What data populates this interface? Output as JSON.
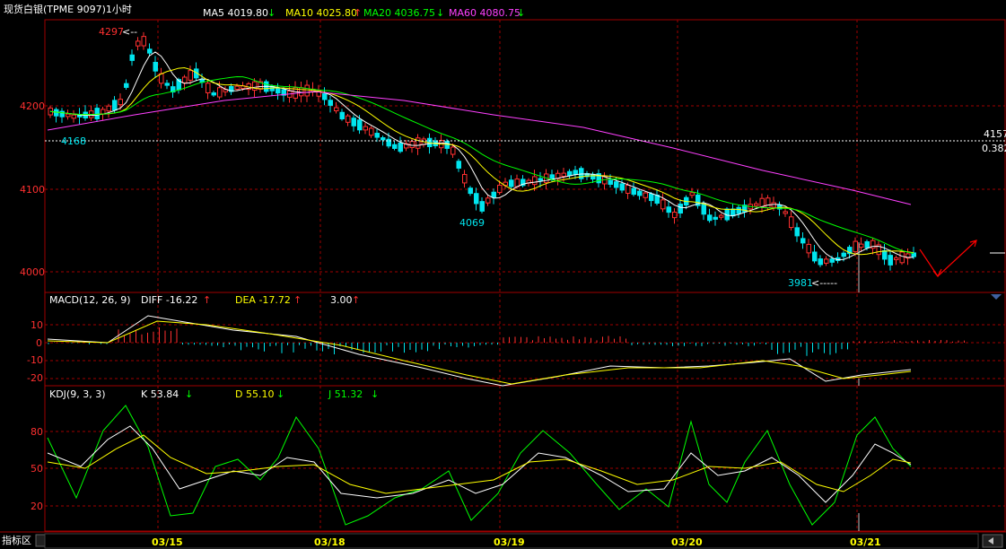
{
  "header": {
    "title": "现货白银(TPME 9097)1小时",
    "ma": [
      {
        "label": "MA5 4019.80",
        "arrow": "↓",
        "color": "#ffffff",
        "arrow_color": "#00ff00"
      },
      {
        "label": "MA10 4025.80",
        "arrow": "↑",
        "color": "#ffff00",
        "arrow_color": "#ff3030"
      },
      {
        "label": "MA20 4036.75",
        "arrow": "↓",
        "color": "#00ff00",
        "arrow_color": "#00ff00"
      },
      {
        "label": "MA60 4080.75",
        "arrow": "↓",
        "color": "#ff40ff",
        "arrow_color": "#00ff00"
      }
    ]
  },
  "price_axis": {
    "ticks": [
      "4200",
      "4100",
      "4000"
    ]
  },
  "price_annotations": {
    "high": "4297",
    "level1": "4168",
    "low1": "4069",
    "low2": "3981",
    "right_level": "4157",
    "right_ratio": "0.382"
  },
  "macd": {
    "name": "MACD(12, 26, 9)",
    "diff_label": "DIFF  -16.22",
    "diff_arrow": "↑",
    "dea_label": "DEA  -17.72",
    "dea_arrow": "↑",
    "macd_label": "3.00",
    "macd_arrow": "↑",
    "ticks": [
      "10",
      "0",
      "-10",
      "-20"
    ]
  },
  "kdj": {
    "name": "KDJ(9, 3, 3)",
    "k_label": "K  53.84",
    "k_arrow": "↓",
    "d_label": "D  55.10",
    "d_arrow": "↓",
    "j_label": "J  51.32",
    "j_arrow": "↓",
    "ticks": [
      "80",
      "50",
      "20"
    ]
  },
  "time_axis": {
    "labels": [
      "03/15",
      "03/18",
      "03/19",
      "03/20",
      "03/21"
    ]
  },
  "footer": {
    "indicator_tab": "指标区"
  },
  "colors": {
    "grid": "#a00000",
    "up": "#ff3030",
    "down": "#00e5ee",
    "ma5": "#ffffff",
    "ma10": "#ffff00",
    "ma20": "#00ff00",
    "ma60": "#ff40ff",
    "arrow": "#ff0000"
  }
}
